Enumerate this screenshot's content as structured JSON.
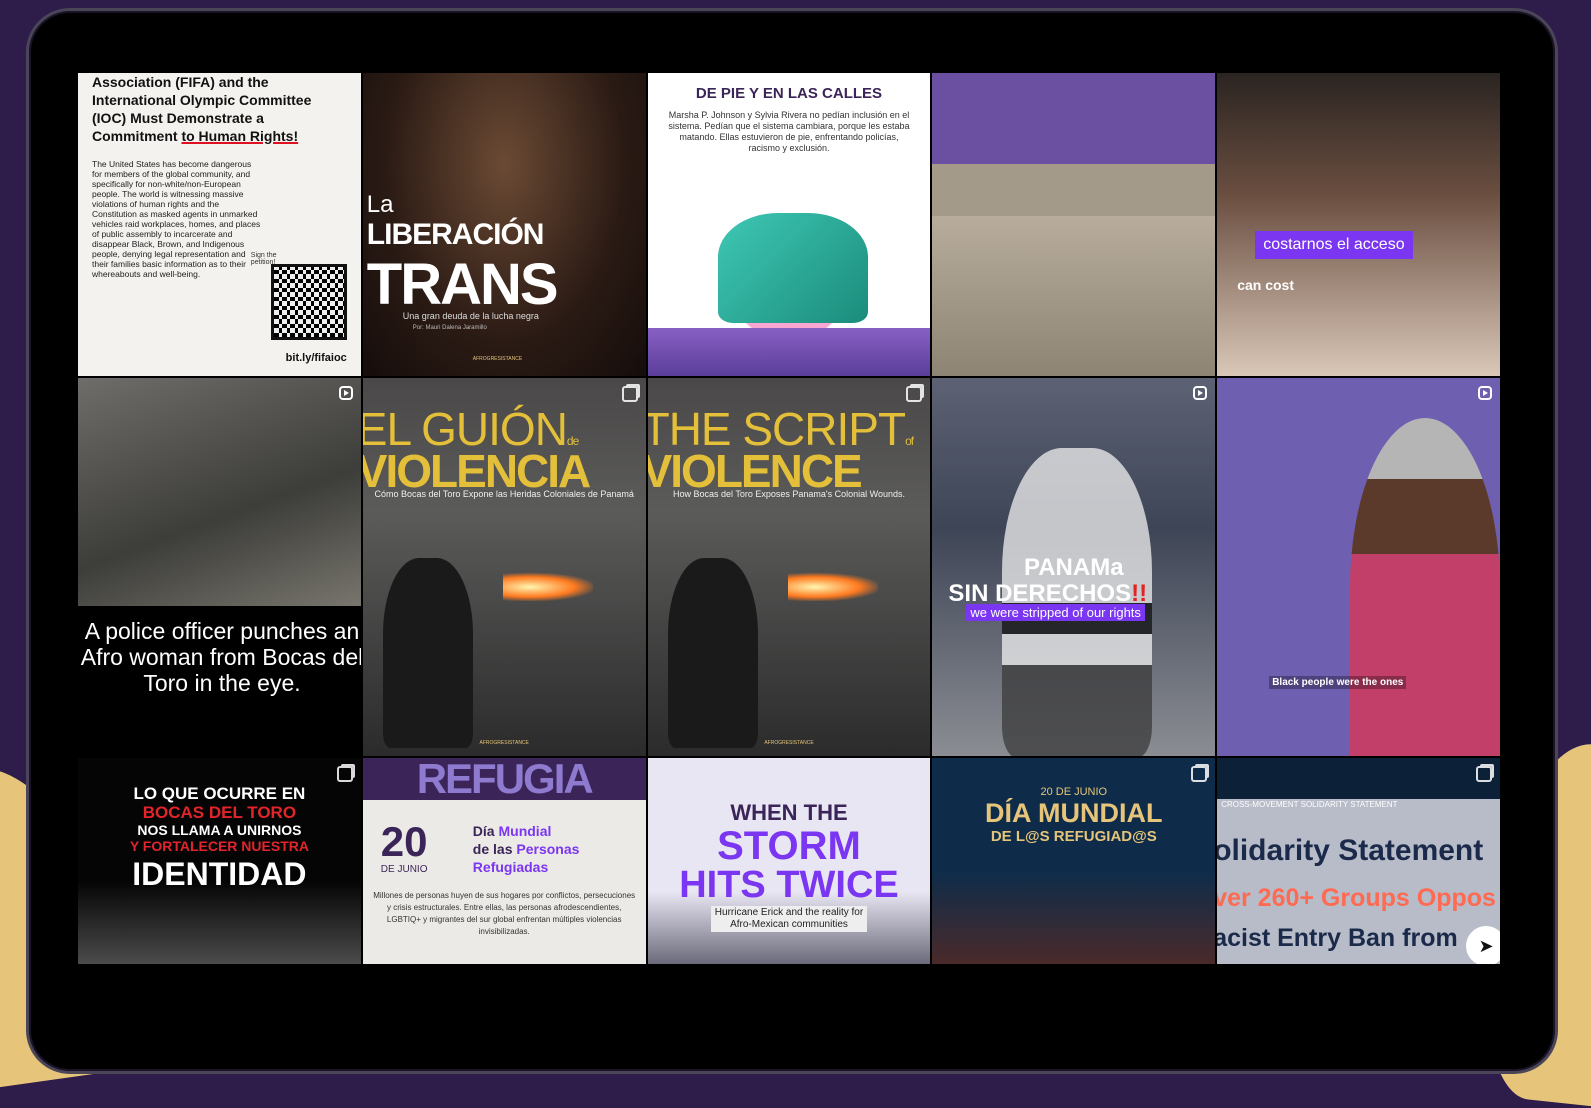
{
  "grid": {
    "t1": {
      "headline_1": "Association (FIFA) and the International Olympic Committee (IOC) Must Demonstrate a Commitment",
      "headline_2": "to Human Rights!",
      "body": "The United States has become dangerous for members of the global community, and specifically for non-white/non-European people. The world is witnessing massive violations of human rights and the Constitution as masked agents in unmarked vehicles raid workplaces, homes, and places of public assembly to incarcerate and disappear Black, Brown, and Indigenous people, denying legal representation and their families basic information as to their whereabouts and well-being.",
      "sign": "Sign the petition!",
      "link": "bit.ly/fifaioc"
    },
    "t2": {
      "la": "La",
      "lib": "LIBERACIÓN",
      "trans": "TRANS",
      "sub": "Una gran deuda de la lucha negra",
      "by": "Por: Mauri Dalena Jaramillo",
      "foot": "AFROGRESISTANCE"
    },
    "t3": {
      "h": "DE PIE Y EN LAS CALLES",
      "p": "Marsha P. Johnson y Sylvia Rivera no pedían inclusión en el sistema. Pedían que el sistema cambiara, porque les estaba matando. Ellas estuvieron de pie, enfrentando policías, racismo y exclusión."
    },
    "t5": {
      "cap1": "costarnos el acceso",
      "cap2": "can cost"
    },
    "t6": {
      "txt": "A police officer punches an Afro woman from Bocas del Toro in the eye."
    },
    "t7": {
      "l1": "EL GUIÓN",
      "de": "de",
      "l2": "VIOLENCIA",
      "sub": "Cómo Bocas del Toro Expone las Heridas Coloniales de Panamá",
      "foot": "AFROGRESISTANCE"
    },
    "t8": {
      "l1": "THE SCRIPT",
      "of": "of",
      "l2": "VIOLENCE",
      "sub": "How Bocas del Toro Exposes Panama's Colonial Wounds.",
      "foot": "AFROGRESISTANCE"
    },
    "t9": {
      "p1": "PANAMa",
      "p2a": "SIN DERECHOS",
      "p2b": "!!",
      "p3": "we were stripped of our rights"
    },
    "t10": {
      "cap": "Black people were the ones"
    },
    "t11": {
      "l1": "LO QUE OCURRE EN",
      "l2": "BOCAS DEL TORO",
      "l3": "NOS LLAMA A UNIRNOS",
      "l4": "Y FORTALECER NUESTRA",
      "l5": "IDENTIDAD"
    },
    "t12": {
      "band": "REFUGIA",
      "num": "20",
      "mes": "DE JUNIO",
      "dia1": "Día",
      "dia2": "Mundial",
      "dia3": "de las",
      "dia4": "Personas",
      "dia5": "Refugiadas",
      "p": "Millones de personas huyen de sus hogares por conflictos, persecuciones y crisis estructurales. Entre ellas, las personas afrodescendientes, LGBTIQ+ y migrantes del sur global enfrentan múltiples violencias invisibilizadas."
    },
    "t13": {
      "a": "WHEN THE",
      "b": "STORM",
      "c": "HITS TWICE",
      "d1": "Hurricane Erick and the reality for",
      "d2": "Afro-Mexican communities"
    },
    "t14": {
      "date": "20 DE JUNIO",
      "dm": "DÍA MUNDIAL",
      "dr": "DE L@S REFUGIAD@S"
    },
    "t15": {
      "top": "CROSS-MOVEMENT SOLIDARITY STATEMENT",
      "s1": "olidarity Statement",
      "s2": "ver 260+ Groups Oppos",
      "s3": "acist Entry Ban from"
    }
  },
  "icons": {
    "reel": "reel-icon",
    "carousel": "carousel-icon",
    "share": "send-icon"
  }
}
